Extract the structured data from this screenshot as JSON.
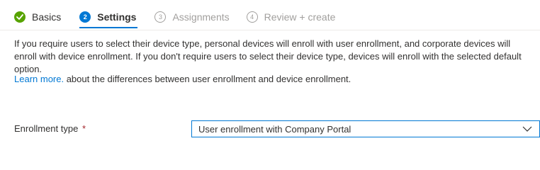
{
  "wizard": {
    "steps": [
      {
        "number": "1",
        "label": "Basics",
        "state": "completed"
      },
      {
        "number": "2",
        "label": "Settings",
        "state": "current"
      },
      {
        "number": "3",
        "label": "Assignments",
        "state": "upcoming"
      },
      {
        "number": "4",
        "label": "Review + create",
        "state": "upcoming"
      }
    ]
  },
  "content": {
    "description": "If you require users to select their device type, personal devices will enroll with user enrollment, and corporate devices will enroll with device enrollment. If you don't require users to select their device type, devices will enroll with the selected default option.",
    "learn_more_link": "Learn more.",
    "learn_more_suffix": " about the differences between user enrollment and device enrollment."
  },
  "form": {
    "enrollment_type": {
      "label": "Enrollment type",
      "required_marker": "*",
      "value": "User enrollment with Company Portal"
    }
  },
  "colors": {
    "accent": "#0078d4",
    "success": "#57a300",
    "disabled": "#a19f9d",
    "required": "#a4262c"
  }
}
